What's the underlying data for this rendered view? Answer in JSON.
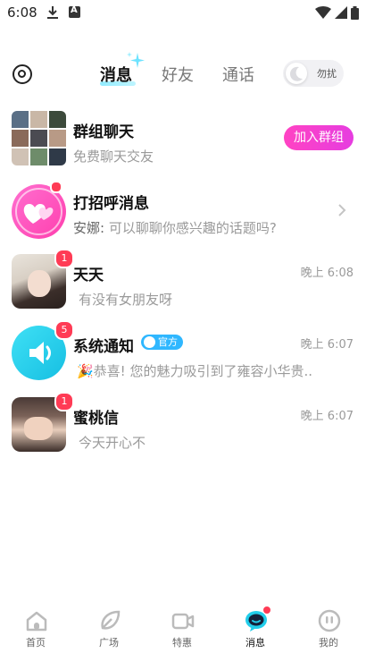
{
  "status_bar": {
    "time": "6:08"
  },
  "top_nav": {
    "tabs": [
      {
        "label": "消息",
        "active": true
      },
      {
        "label": "好友",
        "active": false
      },
      {
        "label": "通话",
        "active": false
      }
    ],
    "dnd_label": "勿扰"
  },
  "chats": [
    {
      "name": "群组聊天",
      "preview": "免费聊天交友",
      "action_label": "加入群组"
    },
    {
      "name": "打招呼消息",
      "preview_sender": "安娜:",
      "preview": " 可以聊聊你感兴趣的话题吗?"
    },
    {
      "name": "天天",
      "preview": "有没有女朋友呀",
      "time": "晚上 6:08",
      "unread": "1"
    },
    {
      "name": "系统通知",
      "tag": "官方",
      "preview": "🎉恭喜! 您的魅力吸引到了雍容小华贵..",
      "time": "晚上 6:07",
      "unread": "5"
    },
    {
      "name": "蜜桃信",
      "preview": "今天开心不",
      "time": "晚上 6:07",
      "unread": "1"
    }
  ],
  "bottom_nav": [
    {
      "label": "首页",
      "icon": "home-icon"
    },
    {
      "label": "广场",
      "icon": "plaza-icon"
    },
    {
      "label": "特惠",
      "icon": "video-icon"
    },
    {
      "label": "消息",
      "icon": "message-icon",
      "active": true
    },
    {
      "label": "我的",
      "icon": "profile-icon"
    }
  ],
  "colors": {
    "accent_pink": "#ff43c3",
    "badge_red": "#ff3b55",
    "notify_cyan": "#22cdea",
    "official_blue": "#2fb7ff"
  }
}
